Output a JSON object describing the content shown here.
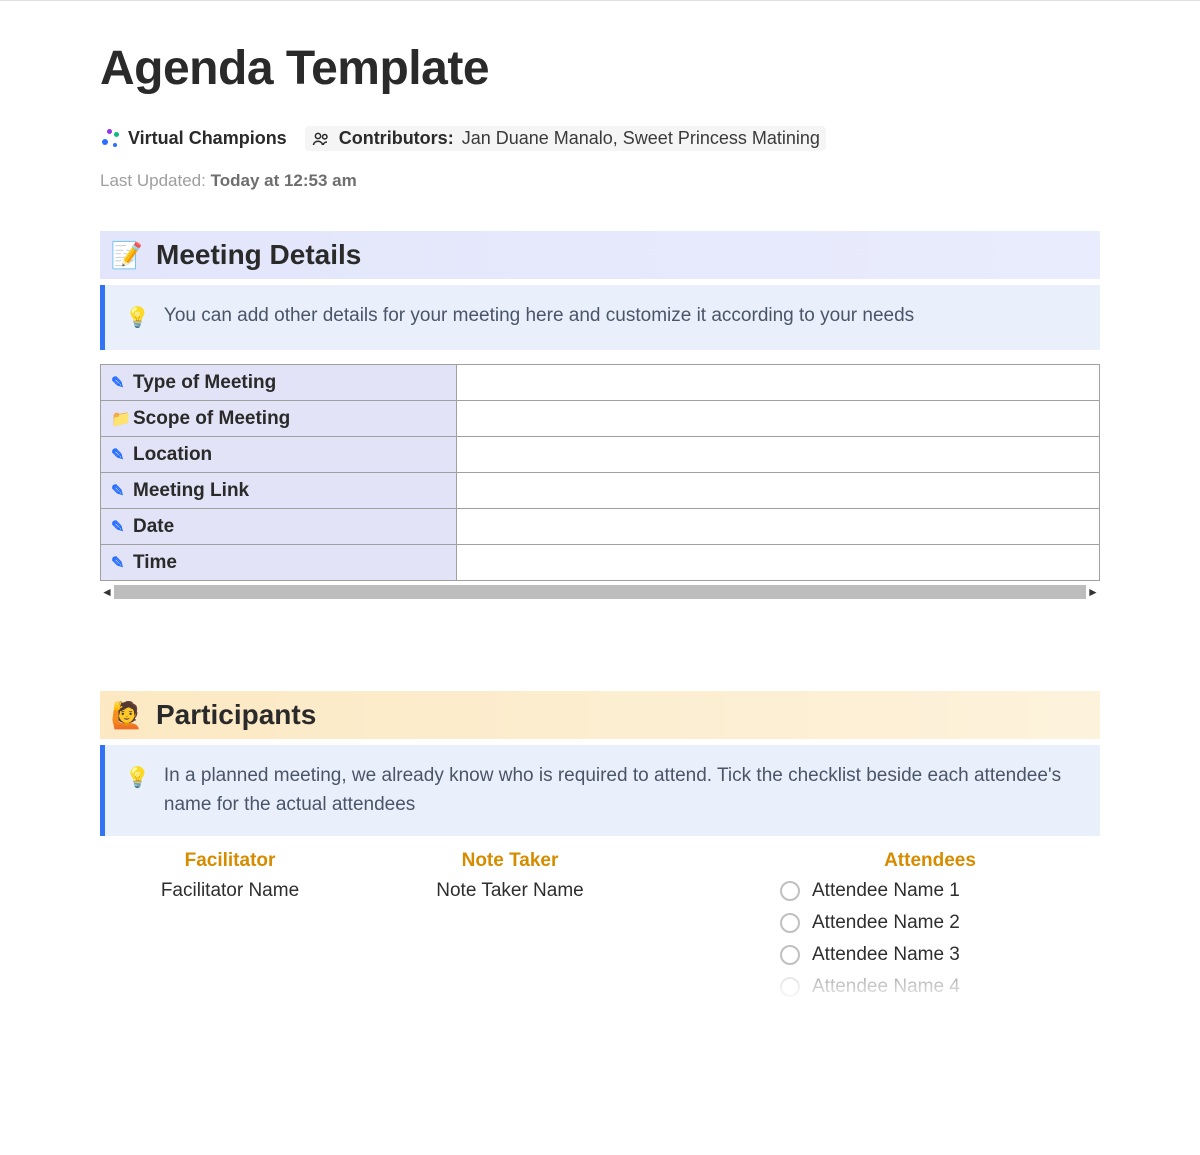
{
  "header": {
    "title": "Agenda Template",
    "team": "Virtual Champions",
    "contributors_label": "Contributors:",
    "contributors": "Jan Duane Manalo, Sweet Princess Matining",
    "last_updated_label": "Last Updated:",
    "last_updated_value": "Today at 12:53 am"
  },
  "section_meeting": {
    "title": "Meeting Details",
    "callout": "You can add other details for your meeting here and customize it according to your needs",
    "rows": [
      {
        "icon": "pencil",
        "label": "Type of Meeting",
        "value": ""
      },
      {
        "icon": "folder",
        "label": "Scope of Meeting",
        "value": ""
      },
      {
        "icon": "pencil",
        "label": "Location",
        "value": ""
      },
      {
        "icon": "pencil",
        "label": "Meeting Link",
        "value": ""
      },
      {
        "icon": "pencil",
        "label": "Date",
        "value": ""
      },
      {
        "icon": "pencil",
        "label": "Time",
        "value": ""
      }
    ]
  },
  "section_participants": {
    "title": "Participants",
    "callout": "In a planned meeting, we already know who is required to attend. Tick the checklist beside each attendee's name for the actual attendees",
    "facilitator_header": "Facilitator",
    "facilitator_name": "Facilitator Name",
    "notetaker_header": "Note Taker",
    "notetaker_name": "Note Taker Name",
    "attendees_header": "Attendees",
    "attendees": [
      "Attendee Name 1",
      "Attendee Name 2",
      "Attendee Name 3",
      "Attendee Name 4"
    ]
  }
}
